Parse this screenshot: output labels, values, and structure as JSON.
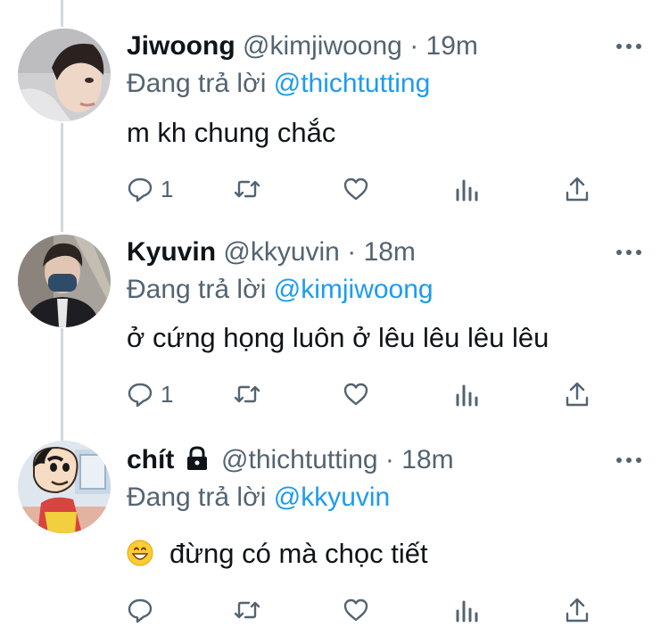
{
  "tweets": [
    {
      "name": "Jiwoong",
      "handle": "@kimjiwoong",
      "separator": "·",
      "time": "19m",
      "replying_prefix": "Đang trả lời",
      "replying_to": "@thichtutting",
      "text": "m kh chung chắc",
      "reply_count": "1",
      "locked": false
    },
    {
      "name": "Kyuvin",
      "handle": "@kkyuvin",
      "separator": "·",
      "time": "18m",
      "replying_prefix": "Đang trả lời",
      "replying_to": "@kimjiwoong",
      "text": "ở cứng họng luôn ở lêu lêu lêu lêu",
      "reply_count": "1",
      "locked": false
    },
    {
      "name": "chít",
      "handle": "@thichtutting",
      "separator": "·",
      "time": "18m",
      "replying_prefix": "Đang trả lời",
      "replying_to": "@kkyuvin",
      "text": "đừng có mà chọc tiết",
      "reply_count": "",
      "locked": true,
      "emoji": "grinning-face"
    }
  ],
  "colors": {
    "primary_text": "#0f1419",
    "secondary_text": "#536471",
    "mention": "#1d9bf0",
    "thread_line": "#cfd9de"
  },
  "icons": [
    "reply-icon",
    "retweet-icon",
    "like-icon",
    "analytics-icon",
    "share-icon",
    "more-icon",
    "lock-icon"
  ]
}
